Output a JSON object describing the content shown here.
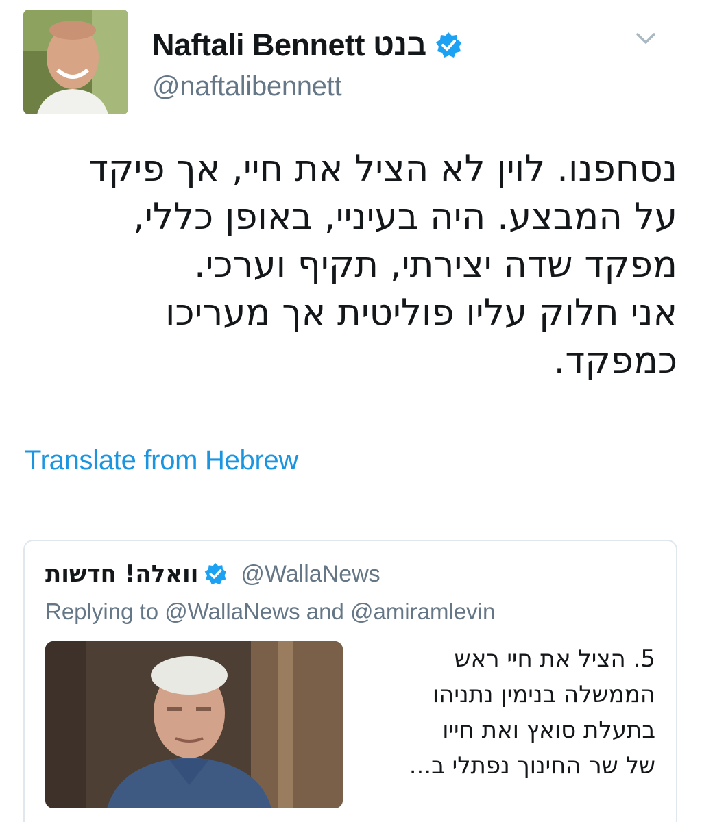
{
  "tweet": {
    "display_name": "Naftali Bennett בנט",
    "handle": "@naftalibennett",
    "verified_icon": "verified-badge-icon",
    "text_lines": [
      "נסחפנו. לוין לא הציל את חיי, אך פיקד",
      "על המבצע. היה בעיניי, באופן כללי,",
      "מפקד שדה יצירתי, תקיף וערכי.",
      "אני חלוק עליו פוליטית אך מעריכו",
      "כמפקד."
    ],
    "translate_label": "Translate from Hebrew"
  },
  "quoted_tweet": {
    "display_name": "וואלה! חדשות",
    "handle": "@WallaNews",
    "replying_to": "Replying to @WallaNews and @amiramlevin",
    "text_lines": [
      "5. הציל את חיי ראש",
      "הממשלה בנימין נתניהו",
      "בתעלת סואץ ואת חייו",
      "של שר החינוך נפתלי ב..."
    ]
  },
  "colors": {
    "link": "#1b95e0",
    "secondary_text": "#657786",
    "verified": "#1da1f2",
    "border": "#e1e8ed"
  }
}
